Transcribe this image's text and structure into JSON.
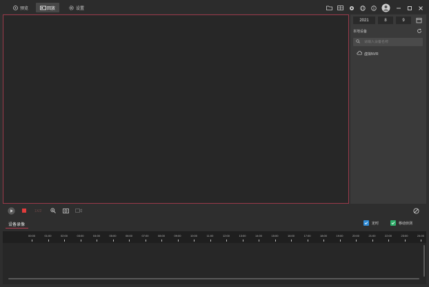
{
  "tabs": [
    {
      "label": "预览",
      "icon": "preview-icon"
    },
    {
      "label": "回放",
      "icon": "playback-icon"
    },
    {
      "label": "设置",
      "icon": "gear-icon"
    }
  ],
  "toolbar_icons": [
    "folder-icon",
    "grid-icon",
    "settings-icon",
    "globe-icon",
    "info-icon",
    "avatar-icon",
    "minimize-icon",
    "maximize-icon",
    "close-icon"
  ],
  "date": {
    "year": "2021",
    "month": "8",
    "day": "9"
  },
  "right_panel": {
    "section_label": "本地设备",
    "search_placeholder": "请输入设备名称",
    "devices": [
      "虚拟NVR"
    ]
  },
  "controls": {
    "speed_label": "1X/2"
  },
  "timeline": {
    "tab_label": "设备录像",
    "checkboxes": [
      {
        "label": "定时",
        "color": "#2f8bd6",
        "checked": true
      },
      {
        "label": "移动侦测",
        "color": "#2fae6a",
        "checked": true
      }
    ],
    "hours": [
      "00:00",
      "01:00",
      "02:00",
      "03:00",
      "04:00",
      "05:00",
      "06:00",
      "07:00",
      "08:00",
      "09:00",
      "10:00",
      "11:00",
      "12:00",
      "13:00",
      "14:00",
      "15:00",
      "16:00",
      "17:00",
      "18:00",
      "19:00",
      "20:00",
      "21:00",
      "22:00",
      "23:00",
      "24:00"
    ]
  },
  "colors": {
    "accent": "#b83c50",
    "video_border": "#9c3a4b",
    "record_button": "#e23c3c"
  }
}
